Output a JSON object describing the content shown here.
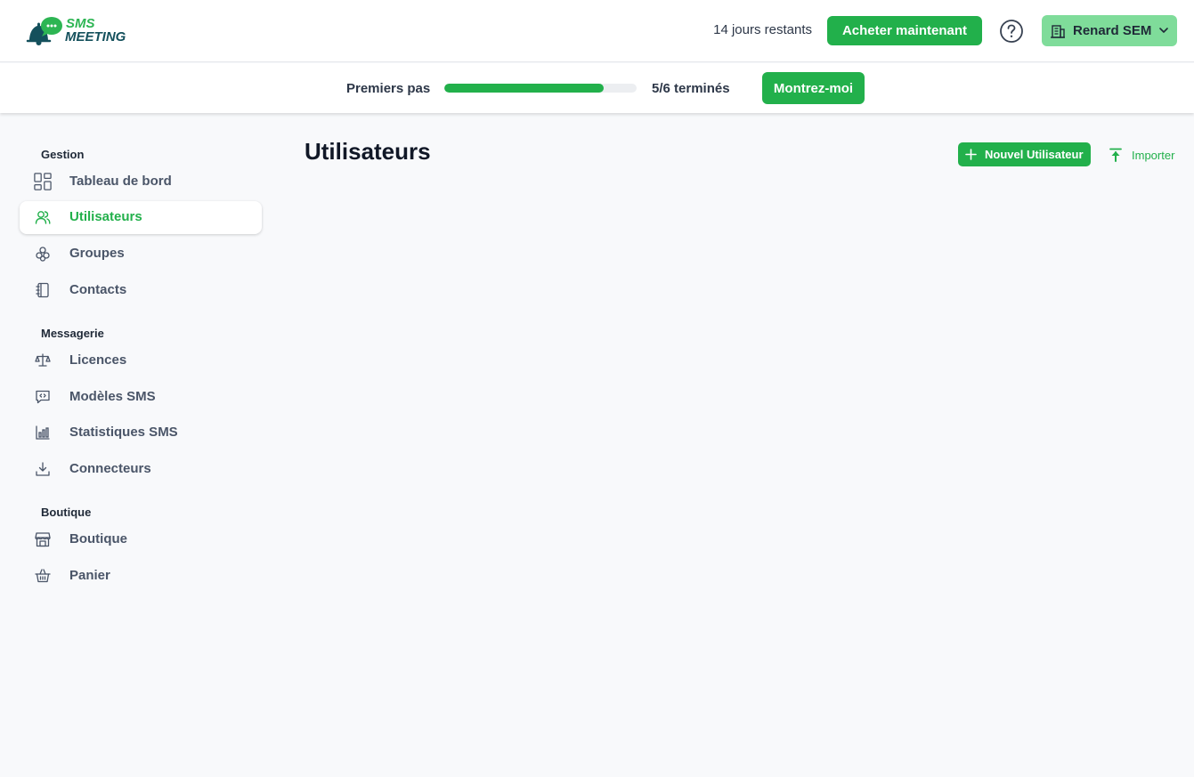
{
  "header": {
    "logo": {
      "line1": "SMS",
      "line2": "MEETING"
    },
    "trial_text": "14 jours restants",
    "buy_label": "Acheter maintenant",
    "account_name": "Renard SEM"
  },
  "onboarding": {
    "label": "Premiers pas",
    "progress": 0.83,
    "status": "5/6 terminés",
    "show_label": "Montrez-moi"
  },
  "sidebar": {
    "sections": [
      {
        "title": "Gestion",
        "items": [
          {
            "label": "Tableau de bord",
            "icon": "dashboard-icon"
          },
          {
            "label": "Utilisateurs",
            "icon": "users-icon",
            "active": true
          },
          {
            "label": "Groupes",
            "icon": "groups-icon"
          },
          {
            "label": "Contacts",
            "icon": "contacts-book-icon"
          }
        ]
      },
      {
        "title": "Messagerie",
        "items": [
          {
            "label": "Licences",
            "icon": "scale-icon"
          },
          {
            "label": "Modèles SMS",
            "icon": "message-code-icon"
          },
          {
            "label": "Statistiques SMS",
            "icon": "bar-chart-icon"
          },
          {
            "label": "Connecteurs",
            "icon": "download-icon"
          }
        ]
      },
      {
        "title": "Boutique",
        "items": [
          {
            "label": "Boutique",
            "icon": "store-icon"
          },
          {
            "label": "Panier",
            "icon": "basket-icon"
          }
        ]
      }
    ]
  },
  "main": {
    "title": "Utilisateurs",
    "new_user_label": "Nouvel Utilisateur",
    "import_label": "Importer"
  },
  "colors": {
    "accent": "#22b04b",
    "accent_light": "#7fdc9a",
    "logo_dark": "#14505c",
    "background": "#f8f9fb"
  }
}
